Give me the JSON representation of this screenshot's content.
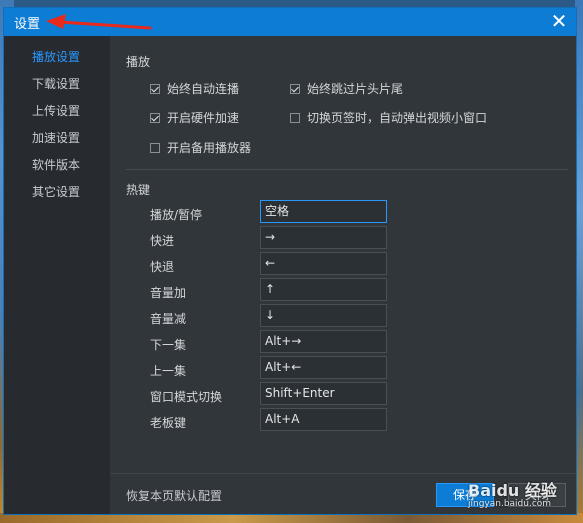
{
  "window": {
    "title": "设置"
  },
  "sidebar": {
    "items": [
      {
        "label": "播放设置",
        "active": true
      },
      {
        "label": "下载设置",
        "active": false
      },
      {
        "label": "上传设置",
        "active": false
      },
      {
        "label": "加速设置",
        "active": false
      },
      {
        "label": "软件版本",
        "active": false
      },
      {
        "label": "其它设置",
        "active": false
      }
    ]
  },
  "playback": {
    "title": "播放",
    "options": [
      {
        "label": "始终自动连播",
        "checked": true
      },
      {
        "label": "始终跳过片头片尾",
        "checked": true
      },
      {
        "label": "开启硬件加速",
        "checked": true
      },
      {
        "label": "切换页签时，自动弹出视频小窗口",
        "checked": false
      },
      {
        "label": "开启备用播放器",
        "checked": false
      }
    ]
  },
  "hotkeys": {
    "title": "热键",
    "items": [
      {
        "label": "播放/暂停",
        "value": "空格"
      },
      {
        "label": "快进",
        "value": "→"
      },
      {
        "label": "快退",
        "value": "←"
      },
      {
        "label": "音量加",
        "value": "↑"
      },
      {
        "label": "音量减",
        "value": "↓"
      },
      {
        "label": "下一集",
        "value": "Alt+→"
      },
      {
        "label": "上一集",
        "value": "Alt+←"
      },
      {
        "label": "窗口模式切换",
        "value": "Shift+Enter"
      },
      {
        "label": "老板键",
        "value": "Alt+A"
      }
    ]
  },
  "footer": {
    "reset_label": "恢复本页默认配置",
    "save_label": "保存",
    "close_label": "关闭"
  },
  "watermark": {
    "brand": "Baidu 经验",
    "url": "jingyan.baidu.com"
  },
  "colors": {
    "accent": "#0c7cd5",
    "active_text": "#2a97ff",
    "annotation": "#e8291c"
  }
}
